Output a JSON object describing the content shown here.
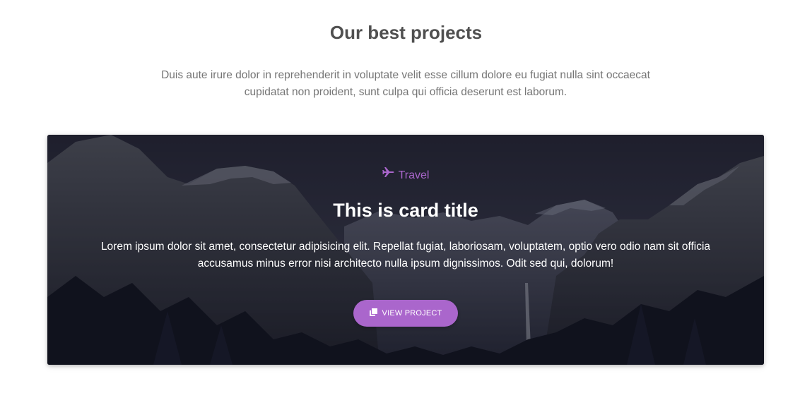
{
  "section": {
    "title": "Our best projects",
    "description": "Duis aute irure dolor in reprehenderit in voluptate velit esse cillum dolore eu fugiat nulla sint occaecat cupidatat non proident, sunt culpa qui officia deserunt est laborum."
  },
  "card": {
    "category_label": "Travel",
    "category_icon": "plane-icon",
    "title": "This is card title",
    "text": "Lorem ipsum dolor sit amet, consectetur adipisicing elit. Repellat fugiat, laboriosam, voluptatem, optio vero odio nam sit officia accusamus minus error nisi architecto nulla ipsum dignissimos. Odit sed qui, dolorum!",
    "button_label": "VIEW PROJECT",
    "button_icon": "clone-icon"
  },
  "colors": {
    "accent": "#aa66cc",
    "title_text": "#4f4f4f",
    "muted_text": "#757575",
    "card_text": "#ffffff"
  }
}
